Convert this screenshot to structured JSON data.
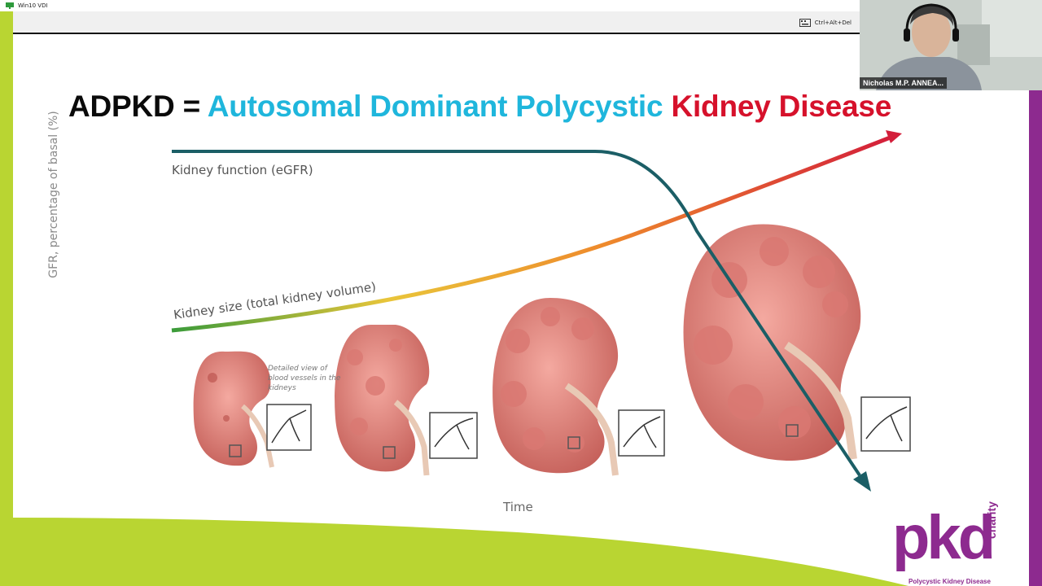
{
  "window": {
    "title": "Win10 VDI",
    "cad_label": "Ctrl+Alt+Del"
  },
  "slide": {
    "title_black": "ADPKD = ",
    "title_blue": "Autosomal Dominant Polycystic ",
    "title_red": "Kidney Disease",
    "y_axis_label": "GFR, percentage of basal (%)",
    "x_axis_label": "Time",
    "curve_function_label": "Kidney function (eGFR)",
    "curve_size_label": "Kidney size (total kidney volume)",
    "detail_caption": "Detailed view of blood vessels in the kidneys"
  },
  "webcam": {
    "participant_name": "Nicholas M.P. ANNEA..."
  },
  "logo": {
    "word": "pkd",
    "side": "charity",
    "subtitle": "Polycystic Kidney Disease"
  },
  "colors": {
    "title_blue": "#1fb6dc",
    "title_red": "#d6112b",
    "function_curve": "#1b5e66",
    "brand_purple": "#8d2a8f",
    "lime": "#b9d532"
  }
}
